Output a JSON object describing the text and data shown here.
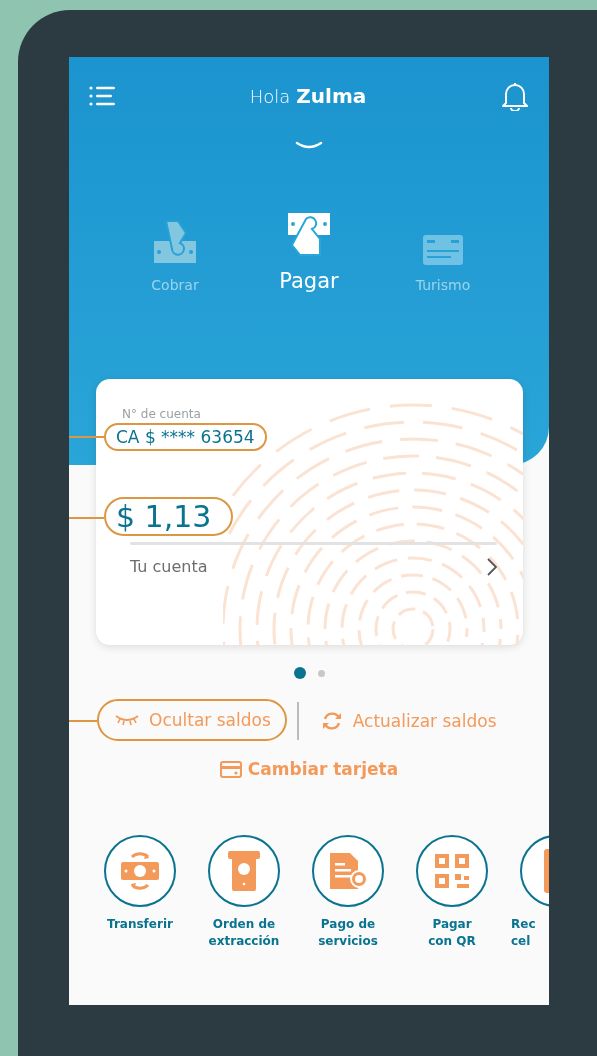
{
  "header": {
    "greeting": "Hola",
    "name": "Zulma"
  },
  "modes": [
    {
      "label": "Cobrar",
      "selected": false
    },
    {
      "label": "Pagar",
      "selected": true
    },
    {
      "label": "Turismo",
      "selected": false
    }
  ],
  "account_card": {
    "account_label": "N° de cuenta",
    "account_number": "CA $ **** 63654",
    "account_callout": true,
    "balance": "$ 1,13",
    "balance_callout": true,
    "link": "Tu cuenta"
  },
  "pager": [
    {
      "selected": true
    },
    {
      "selected": false
    }
  ],
  "actions": [
    {
      "label": "Ocultar saldos",
      "callout": true
    },
    {
      "label": "Actualizar saldos",
      "callout": false
    }
  ],
  "change_card": "Cambiar tarjeta",
  "shortcuts": [
    {
      "lines": [
        "Transferir"
      ],
      "kind": "full"
    },
    {
      "lines": [
        "Orden de",
        "extracción"
      ],
      "kind": "full"
    },
    {
      "lines": [
        "Pago de",
        "servicios"
      ],
      "kind": "full"
    },
    {
      "lines": [
        "Pagar",
        "con QR"
      ],
      "kind": "full"
    },
    {
      "lines": [
        "Rec",
        "cel"
      ],
      "kind": "partial"
    }
  ]
}
